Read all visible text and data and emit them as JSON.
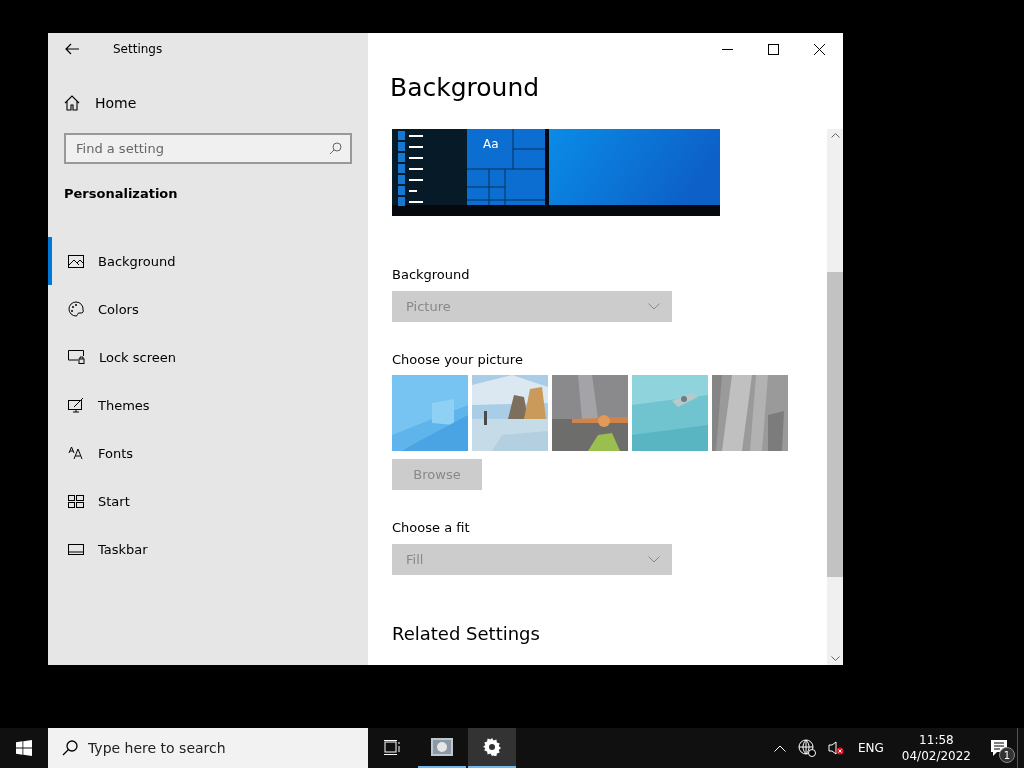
{
  "window": {
    "title": "Settings"
  },
  "sidebar": {
    "home": "Home",
    "search": {
      "placeholder": "Find a setting"
    },
    "section": "Personalization",
    "items": [
      {
        "label": "Background",
        "selected": true
      },
      {
        "label": "Colors",
        "selected": false
      },
      {
        "label": "Lock screen",
        "selected": false
      },
      {
        "label": "Themes",
        "selected": false
      },
      {
        "label": "Fonts",
        "selected": false
      },
      {
        "label": "Start",
        "selected": false
      },
      {
        "label": "Taskbar",
        "selected": false
      }
    ]
  },
  "content": {
    "title": "Background",
    "preview": {
      "sample_text": "Aa"
    },
    "background_label": "Background",
    "background_dropdown": {
      "value": "Picture",
      "disabled": true
    },
    "picture_label": "Choose your picture",
    "browse_button": {
      "label": "Browse",
      "disabled": true
    },
    "fit_label": "Choose a fit",
    "fit_dropdown": {
      "value": "Fill",
      "disabled": true
    },
    "related_heading": "Related Settings"
  },
  "taskbar": {
    "search": {
      "placeholder": "Type here to search"
    },
    "apps": [
      {
        "active": false
      },
      {
        "active": true
      }
    ],
    "language": "ENG",
    "time": "11:58",
    "date": "04/02/2022",
    "notification_count": "1"
  }
}
